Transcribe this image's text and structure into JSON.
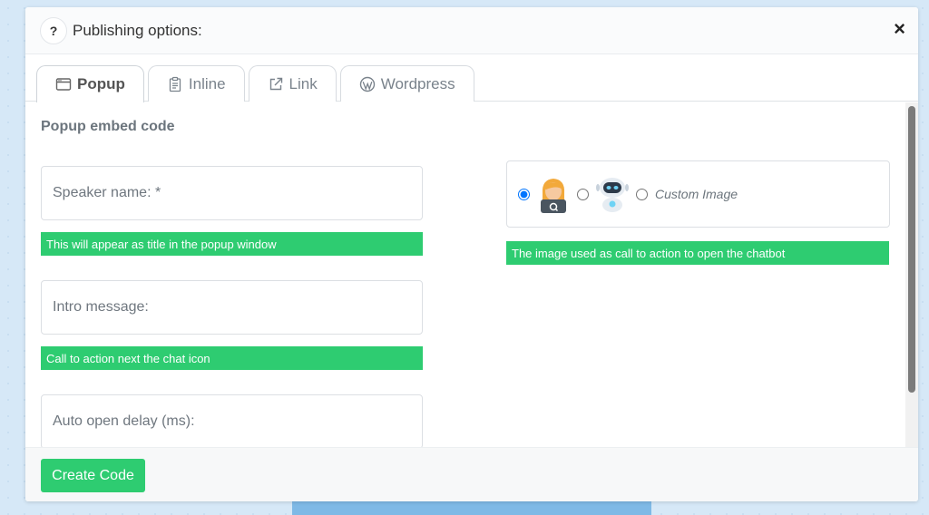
{
  "modal": {
    "title": "Publishing options:",
    "help_glyph": "?",
    "close_glyph": "×"
  },
  "tabs": [
    {
      "label": "Popup",
      "icon": "window-icon",
      "active": true
    },
    {
      "label": "Inline",
      "icon": "clipboard-icon",
      "active": false
    },
    {
      "label": "Link",
      "icon": "external-link-icon",
      "active": false
    },
    {
      "label": "Wordpress",
      "icon": "wordpress-icon",
      "active": false
    }
  ],
  "section": {
    "title": "Popup embed code"
  },
  "fields": {
    "speaker_name": {
      "placeholder": "Speaker name: *",
      "value": "",
      "hint": "This will appear as title in the popup window"
    },
    "intro_message": {
      "placeholder": "Intro message:",
      "value": "",
      "hint": "Call to action next the chat icon"
    },
    "auto_open_delay": {
      "placeholder": "Auto open delay (ms):",
      "value": ""
    }
  },
  "image_options": {
    "selected": "woman-avatar",
    "custom_label": "Custom Image",
    "hint": "The image used as call to action to open the chatbot"
  },
  "footer": {
    "create_label": "Create Code"
  },
  "colors": {
    "accent_green": "#2ecc71",
    "radio_blue": "#1a73e8"
  }
}
